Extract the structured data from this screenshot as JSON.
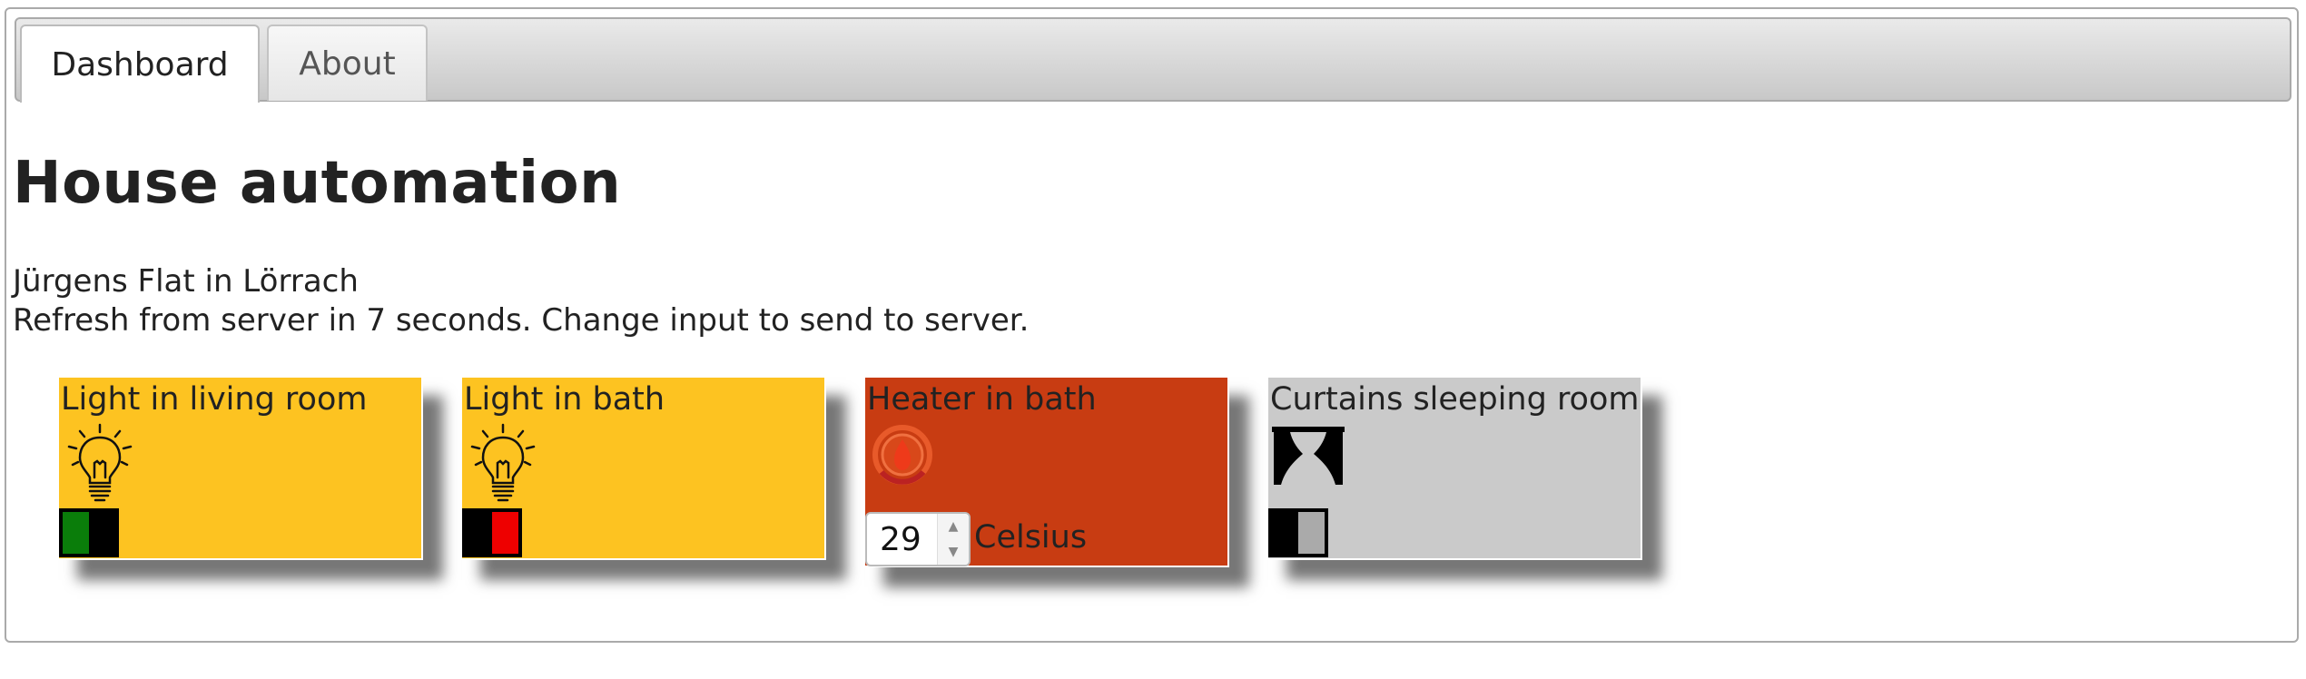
{
  "tabs": [
    {
      "label": "Dashboard",
      "active": true
    },
    {
      "label": "About",
      "active": false
    }
  ],
  "header": {
    "title": "House automation",
    "subtitle": "Jürgens Flat in Lörrach",
    "refresh_text": "Refresh from server in 7 seconds. Change input to send to server."
  },
  "devices": [
    {
      "title": "Light in living room",
      "icon": "lightbulb-icon",
      "switch": {
        "left_color": "#0a7d0a",
        "right_color": "#000000",
        "state": "on"
      }
    },
    {
      "title": "Light in bath",
      "icon": "lightbulb-icon",
      "switch": {
        "left_color": "#000000",
        "right_color": "#ee0000",
        "state": "off"
      }
    },
    {
      "title": "Heater in bath",
      "icon": "heater-flame-icon",
      "temperature": "29",
      "unit": "Celsius"
    },
    {
      "title": "Curtains sleeping room",
      "icon": "curtain-icon",
      "switch": {
        "left_color": "#000000",
        "right_color": "#aaaaaa",
        "state": "closed"
      }
    }
  ],
  "colors": {
    "light_card": "#fdc321",
    "heater_card": "#c83c12",
    "curtain_card": "#cacaca"
  }
}
